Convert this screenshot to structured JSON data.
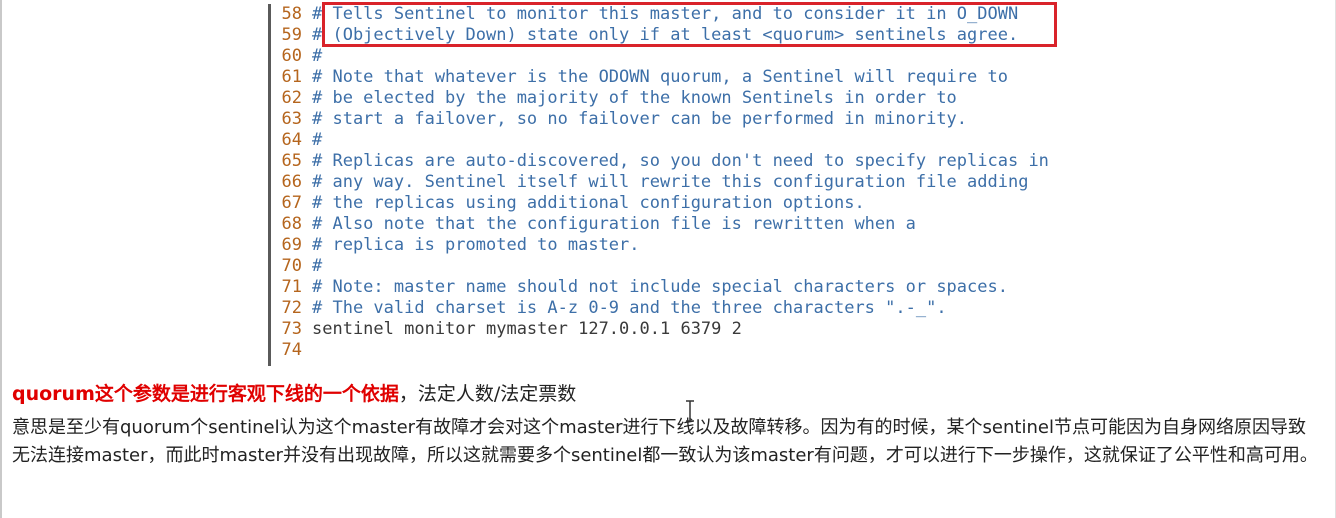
{
  "editor": {
    "lines": [
      {
        "num": "58",
        "text": "# Tells Sentinel to monitor this master, and to consider it in O_DOWN",
        "kind": "comment"
      },
      {
        "num": "59",
        "text": "# (Objectively Down) state only if at least <quorum> sentinels agree.",
        "kind": "comment"
      },
      {
        "num": "60",
        "text": "#",
        "kind": "comment"
      },
      {
        "num": "61",
        "text": "# Note that whatever is the ODOWN quorum, a Sentinel will require to",
        "kind": "comment"
      },
      {
        "num": "62",
        "text": "# be elected by the majority of the known Sentinels in order to",
        "kind": "comment"
      },
      {
        "num": "63",
        "text": "# start a failover, so no failover can be performed in minority.",
        "kind": "comment"
      },
      {
        "num": "64",
        "text": "#",
        "kind": "comment"
      },
      {
        "num": "65",
        "text": "# Replicas are auto-discovered, so you don't need to specify replicas in",
        "kind": "comment"
      },
      {
        "num": "66",
        "text": "# any way. Sentinel itself will rewrite this configuration file adding",
        "kind": "comment"
      },
      {
        "num": "67",
        "text": "# the replicas using additional configuration options.",
        "kind": "comment"
      },
      {
        "num": "68",
        "text": "# Also note that the configuration file is rewritten when a",
        "kind": "comment"
      },
      {
        "num": "69",
        "text": "# replica is promoted to master.",
        "kind": "comment"
      },
      {
        "num": "70",
        "text": "#",
        "kind": "comment"
      },
      {
        "num": "71",
        "text": "# Note: master name should not include special characters or spaces.",
        "kind": "comment"
      },
      {
        "num": "72",
        "text": "# The valid charset is A-z 0-9 and the three characters \".-_\".",
        "kind": "comment"
      },
      {
        "num": "73",
        "text": "sentinel monitor mymaster 127.0.0.1 6379 2",
        "kind": "normal"
      },
      {
        "num": "74",
        "text": "",
        "kind": "normal"
      }
    ]
  },
  "notes": {
    "heading_bold": "quorum这个参数是进行客观下线的一个依据",
    "heading_rest": "，法定人数/法定票数",
    "paragraph": "意思是至少有quorum个sentinel认为这个master有故障才会对这个master进行下线以及故障转移。因为有的时候，某个sentinel节点可能因为自身网络原因导致无法连接master，而此时master并没有出现故障，所以这就需要多个sentinel都一致认为该master有问题，才可以进行下一步操作，这就保证了公平性和高可用。"
  },
  "colors": {
    "line_number": "#b5651d",
    "comment_text": "#3d6fa8",
    "code_text": "#3a3a3a",
    "highlight_border": "#d9232a",
    "heading_red": "#e00000"
  },
  "icons": {
    "text_cursor": "i-beam-cursor-icon"
  }
}
